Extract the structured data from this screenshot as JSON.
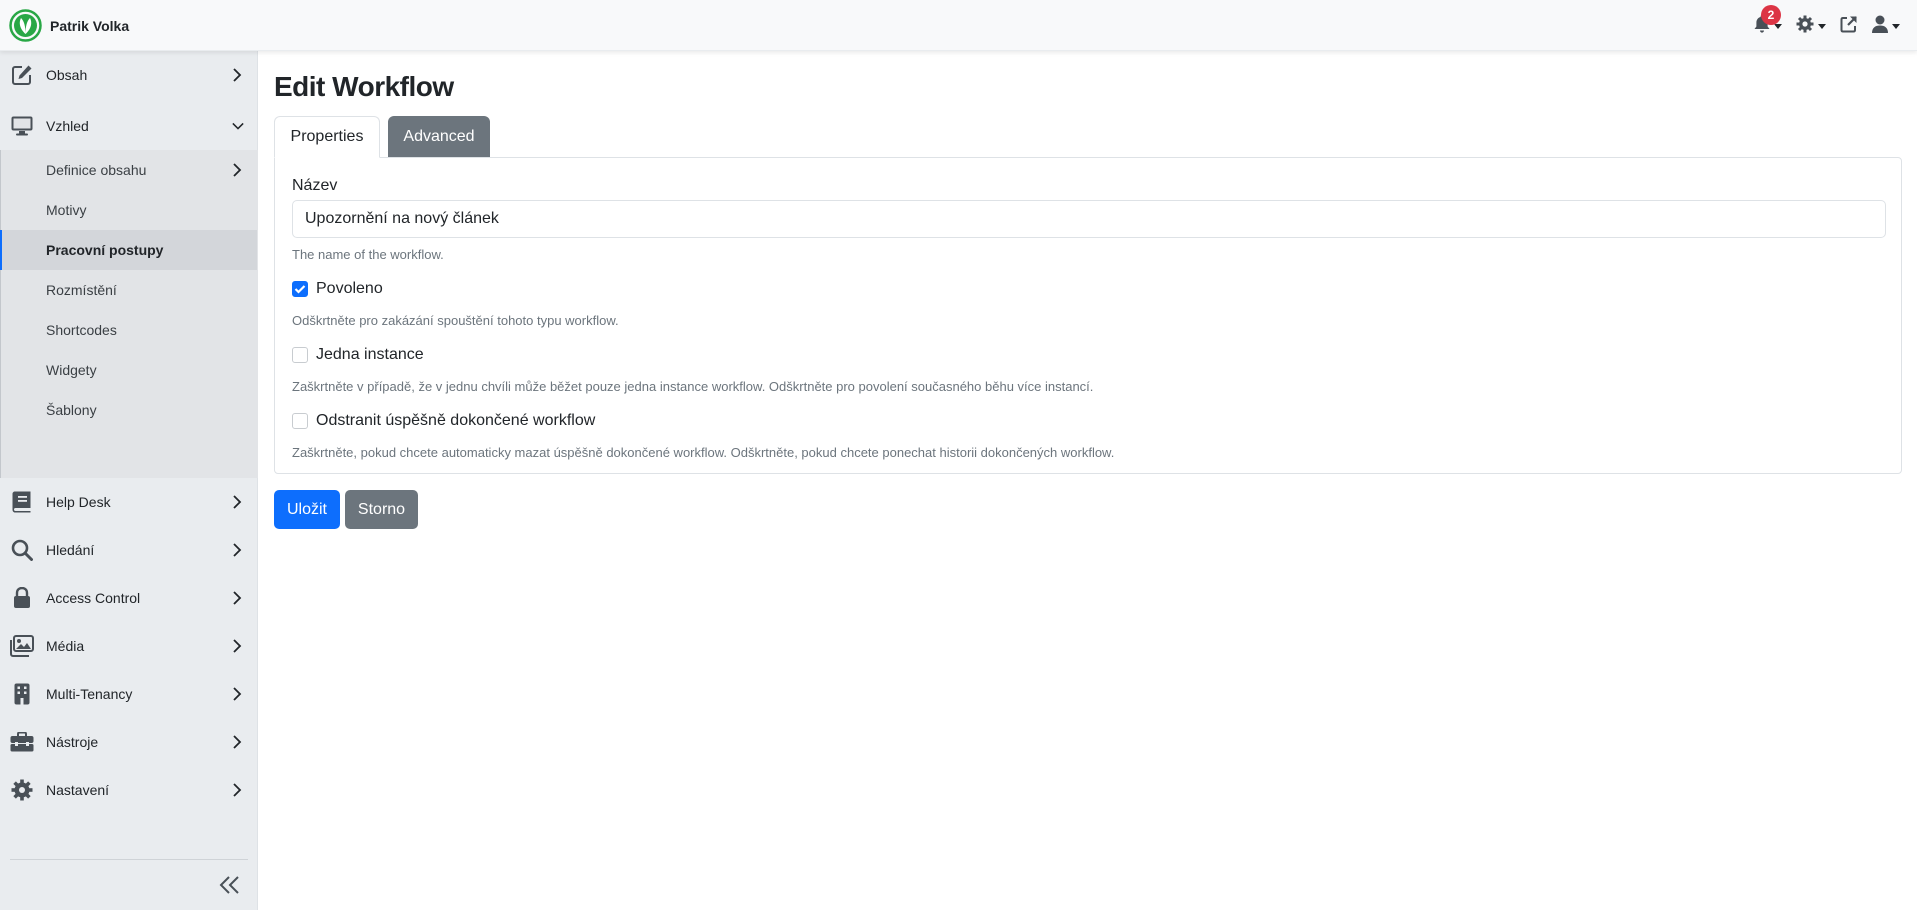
{
  "header": {
    "brand_name": "Patrik Volka",
    "notifications_count": "2",
    "icons": [
      "leaf-logo",
      "bell-icon",
      "gear-icon",
      "external-link-icon",
      "user-icon"
    ]
  },
  "sidebar": {
    "items": [
      {
        "label": "Obsah",
        "icon": "edit-icon"
      },
      {
        "label": "Vzhled",
        "icon": "monitor-icon"
      },
      {
        "label": "Help Desk",
        "icon": "book-icon"
      },
      {
        "label": "Hledání",
        "icon": "search-icon"
      },
      {
        "label": "Access Control",
        "icon": "lock-icon"
      },
      {
        "label": "Média",
        "icon": "images-icon"
      },
      {
        "label": "Multi-Tenancy",
        "icon": "building-icon"
      },
      {
        "label": "Nástroje",
        "icon": "toolbox-icon"
      },
      {
        "label": "Nastavení",
        "icon": "gear-icon"
      }
    ],
    "subitems": [
      {
        "label": "Definice obsahu"
      },
      {
        "label": "Motivy"
      },
      {
        "label": "Pracovní postupy",
        "active": true
      },
      {
        "label": "Rozmístění"
      },
      {
        "label": "Shortcodes"
      },
      {
        "label": "Widgety"
      },
      {
        "label": "Šablony"
      }
    ]
  },
  "main": {
    "title": "Edit Workflow",
    "tabs": [
      {
        "label": "Properties",
        "active": true
      },
      {
        "label": "Advanced",
        "active": false
      }
    ],
    "form": {
      "name_label": "Název",
      "name_value": "Upozornění na nový článek",
      "name_help": "The name of the workflow.",
      "enabled_label": "Povoleno",
      "enabled_checked": true,
      "enabled_help": "Odškrtněte pro zakázání spouštění tohoto typu workflow.",
      "singleton_label": "Jedna instance",
      "singleton_checked": false,
      "singleton_help": "Zaškrtněte v případě, že v jednu chvíli může běžet pouze jedna instance workflow. Odškrtněte pro povolení současného běhu více instancí.",
      "delete_label": "Odstranit úspěšně dokončené workflow",
      "delete_checked": false,
      "delete_help": "Zaškrtněte, pokud chcete automaticky mazat úspěšně dokončené workflow. Odškrtněte, pokud chcete ponechat historii dokončených workflow."
    },
    "buttons": {
      "save": "Uložit",
      "cancel": "Storno"
    }
  },
  "colors": {
    "primary": "#0d6efd",
    "secondary": "#6c757d",
    "danger": "#dc3545",
    "sidebar_bg": "#e9ecef",
    "brand_green": "#28a745"
  }
}
